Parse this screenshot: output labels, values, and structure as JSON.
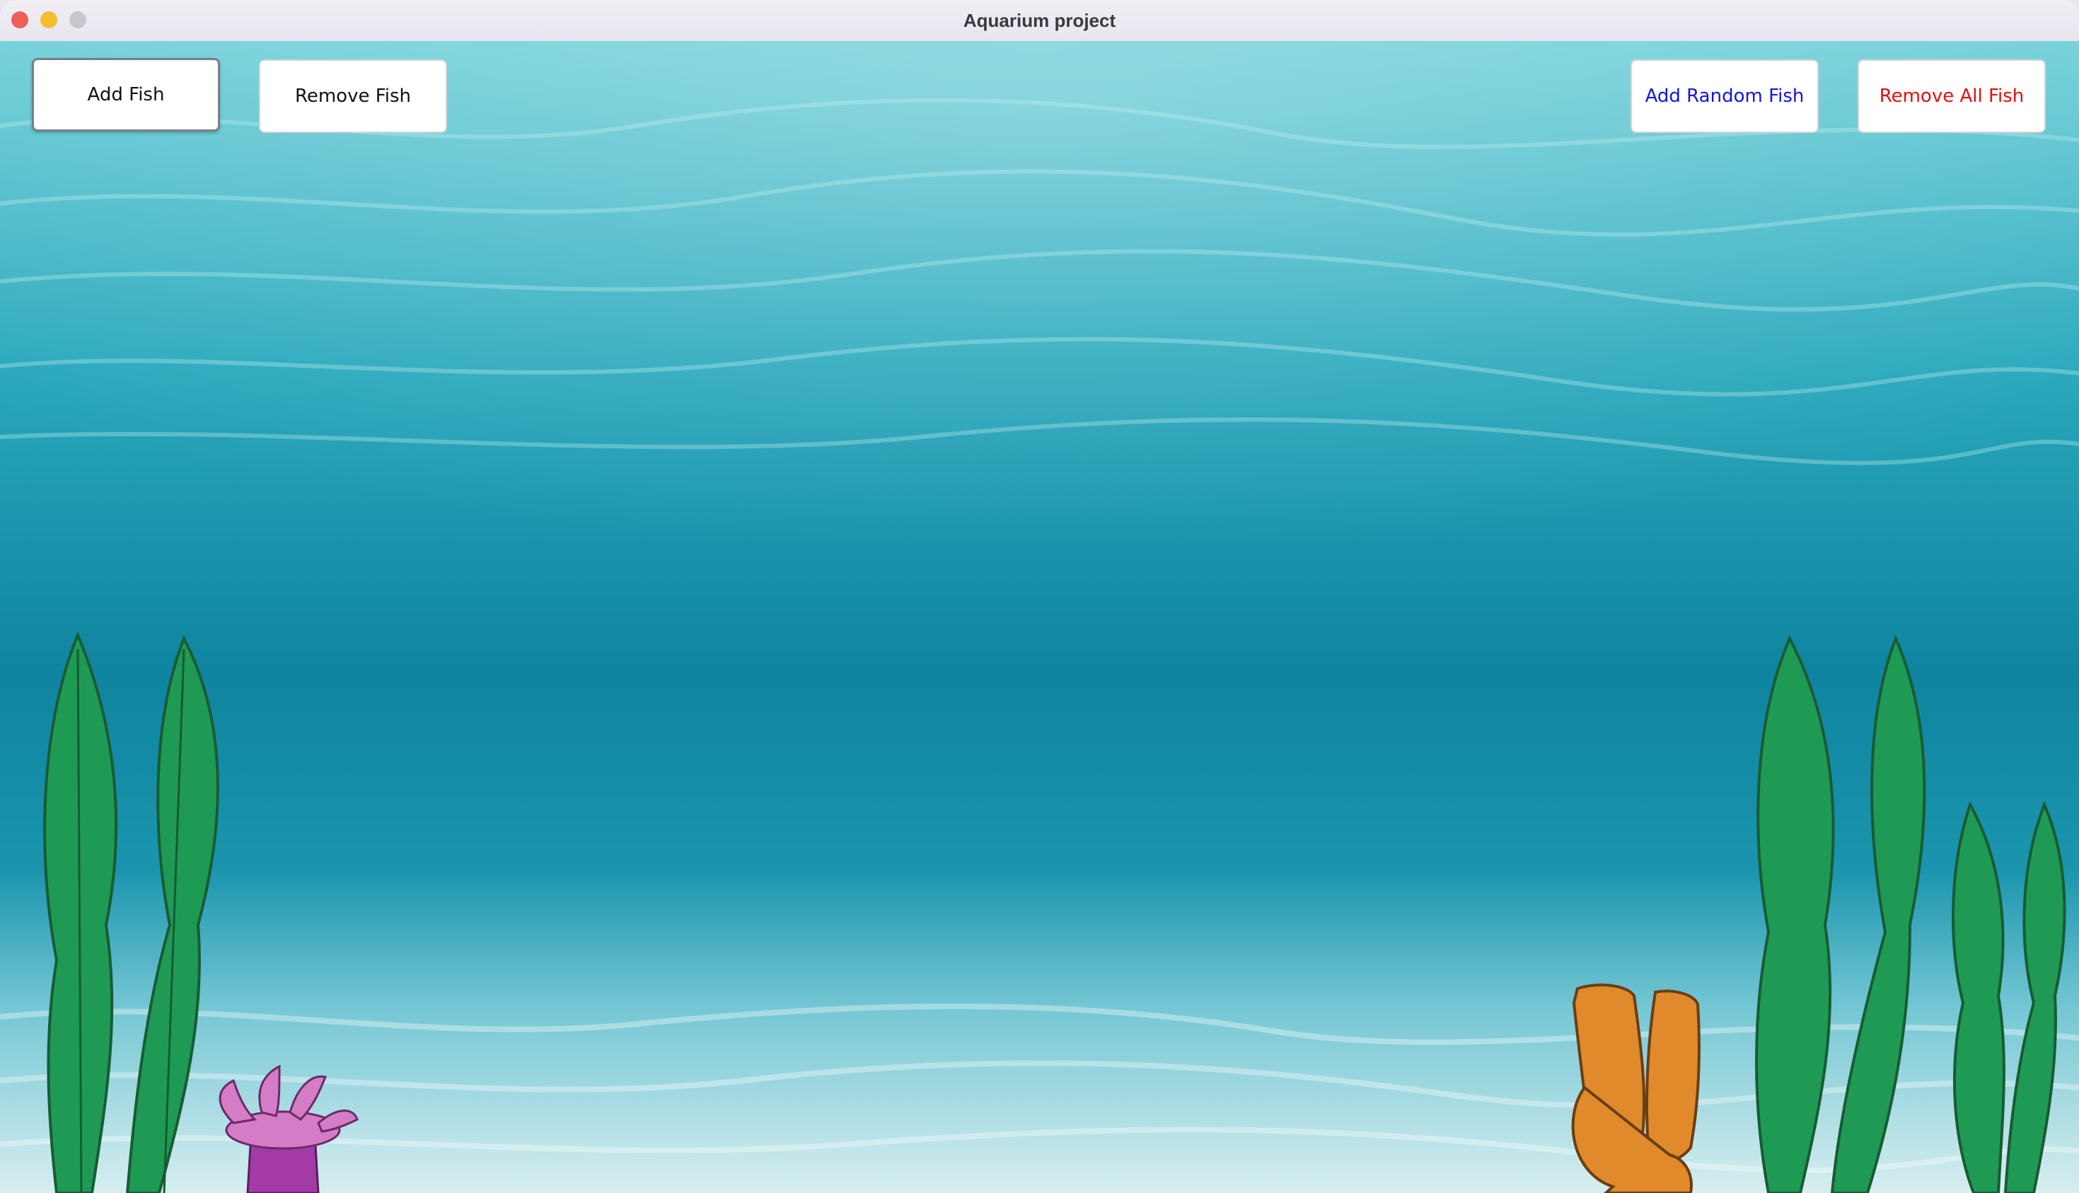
{
  "window": {
    "title": "Aquarium project"
  },
  "toolbar": {
    "add_fish": "Add Fish",
    "remove_fish": "Remove Fish",
    "add_random_fish": "Add Random Fish",
    "remove_all_fish": "Remove All Fish"
  },
  "colors": {
    "water_top": "#5fc6d2",
    "water_mid": "#1a8fa6",
    "water_deep": "#0f7e9a",
    "sand": "#d4ecee",
    "seaweed": "#1f9a55",
    "seaweed_stroke": "#185c34",
    "anemone": "#d57cc6",
    "sponge": "#e08a2c",
    "random_button_text": "#1515e0",
    "remove_all_text": "#e60f0f"
  },
  "decorations": [
    "seaweed-left",
    "seaweed-left-tall",
    "anemone",
    "sponge",
    "seaweed-right",
    "seaweed-right-tall",
    "seaweed-right-small"
  ]
}
